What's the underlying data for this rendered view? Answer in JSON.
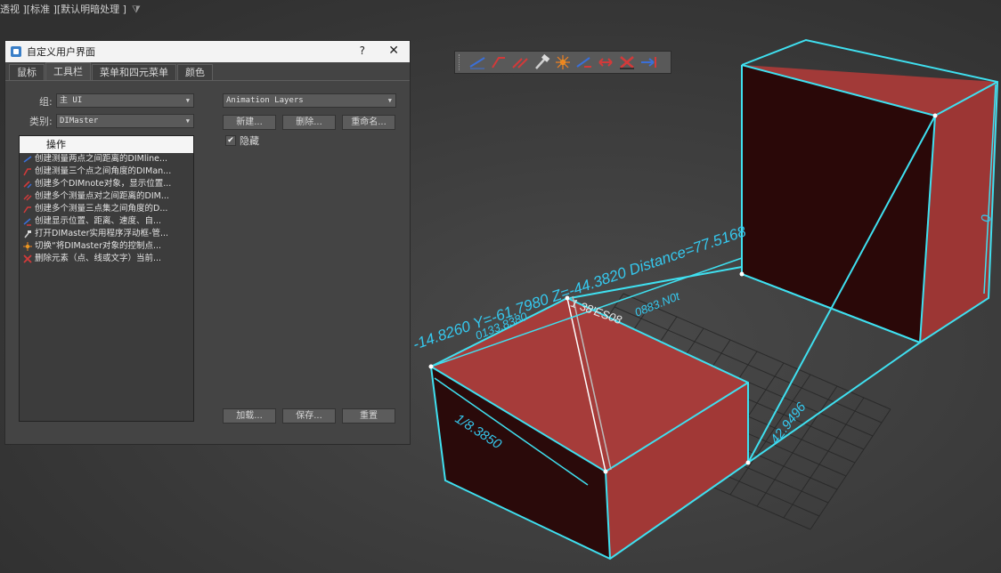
{
  "viewport": {
    "label": "透视 ][标准 ][默认明暗处理 ]",
    "filter_icon": "funnel-icon",
    "dimensions": {
      "coords": "-14.8260 Y=-61.7980 Z=-44.3820 Distance=77.5168",
      "left_top": "0133.8380",
      "diag_short": "1 38'ES08",
      "mid_top": "0883.N0t",
      "left_bottom": "1/8.3850",
      "right_bottom": "42.9496",
      "right_side": "0"
    }
  },
  "toolbar": {
    "buttons": [
      {
        "name": "dim-line-icon",
        "color": "#3a6fd8"
      },
      {
        "name": "dim-angle-icon",
        "color": "#d23a3a"
      },
      {
        "name": "dim-note-icon",
        "color": "#d23a3a"
      },
      {
        "name": "hammer-icon",
        "color": "#cfcfcf"
      },
      {
        "name": "star-burst-icon",
        "color": "#f0c020"
      },
      {
        "name": "multi-note-icon",
        "color": "#3a6fd8"
      },
      {
        "name": "dim-arrows-icon",
        "color": "#d23a3a"
      },
      {
        "name": "delete-x-icon",
        "color": "#d23a3a"
      },
      {
        "name": "dim-arrow-right-icon",
        "color": "#3a6fd8"
      }
    ]
  },
  "dialog": {
    "title": "自定义用户界面",
    "help": "?",
    "close": "✕",
    "tabs": [
      "鼠标",
      "工具栏",
      "菜单和四元菜单",
      "颜色"
    ],
    "active_tab": "工具栏",
    "group_label": "组:",
    "group_value": "主 UI",
    "category_label": "类别:",
    "category_value": "DIMaster",
    "actions_header": "操作",
    "actions": [
      {
        "icon": "dim-line-icon",
        "label": "创建测量两点之间距离的DIMline..."
      },
      {
        "icon": "dim-angle-icon",
        "label": "创建测量三个点之间角度的DIMan..."
      },
      {
        "icon": "dim-note-icon",
        "label": "创建多个DIMnote对象，显示位置..."
      },
      {
        "icon": "dim-pairs-icon",
        "label": "创建多个测量点对之间距离的DIM..."
      },
      {
        "icon": "dim-angle-set-icon",
        "label": "创建多个测量三点集之间角度的D..."
      },
      {
        "icon": "dim-info-icon",
        "label": "创建显示位置、距离、速度、自..."
      },
      {
        "icon": "hammer-icon",
        "label": "打开DIMaster实用程序浮动框-管..."
      },
      {
        "icon": "star-burst-icon",
        "label": "切换“将DIMaster对象的控制点..."
      },
      {
        "icon": "delete-x-icon",
        "label": "删除元素（点、线或文字）当前..."
      }
    ],
    "toolbar_select": "Animation Layers",
    "new_btn": "新建...",
    "delete_btn": "删除...",
    "rename_btn": "重命名...",
    "hide_label": "隐藏",
    "hide_checked": "✔",
    "load_btn": "加载...",
    "save_btn": "保存...",
    "reset_btn": "重置"
  }
}
